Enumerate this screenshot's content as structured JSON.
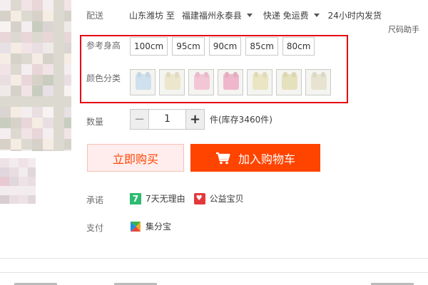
{
  "shipping": {
    "label": "配送",
    "origin": "山东潍坊 至",
    "destination": "福建福州永泰县",
    "method": "快递 免运费",
    "delivery_time": "24小时内发货"
  },
  "size_help": "尺码助手",
  "size_group": {
    "label": "参考身高",
    "options": [
      "100cm",
      "95cm",
      "90cm",
      "85cm",
      "80cm"
    ]
  },
  "color_group": {
    "label": "颜色分类",
    "swatch_colors": [
      "#cfe0ee",
      "#ece6cc",
      "#f3c6d6",
      "#eeb7cb",
      "#ebe5c4",
      "#e6e1bd",
      "#e7e3d0"
    ]
  },
  "quantity": {
    "label": "数量",
    "minus": "−",
    "value": "1",
    "plus": "+",
    "stock": "件(库存3460件)"
  },
  "buttons": {
    "buy_now": "立即购买",
    "add_to_cart": "加入购物车"
  },
  "promise": {
    "label": "承诺",
    "items": [
      {
        "icon": "7-day-return-icon",
        "text": "7天无理由"
      },
      {
        "icon": "charity-heart-icon",
        "text": "公益宝贝"
      }
    ]
  },
  "payment": {
    "label": "支付",
    "method": "集分宝"
  },
  "colors": {
    "accent": "#ff4400",
    "highlight_border": "#e60012",
    "buy_bg": "#ffeded"
  }
}
